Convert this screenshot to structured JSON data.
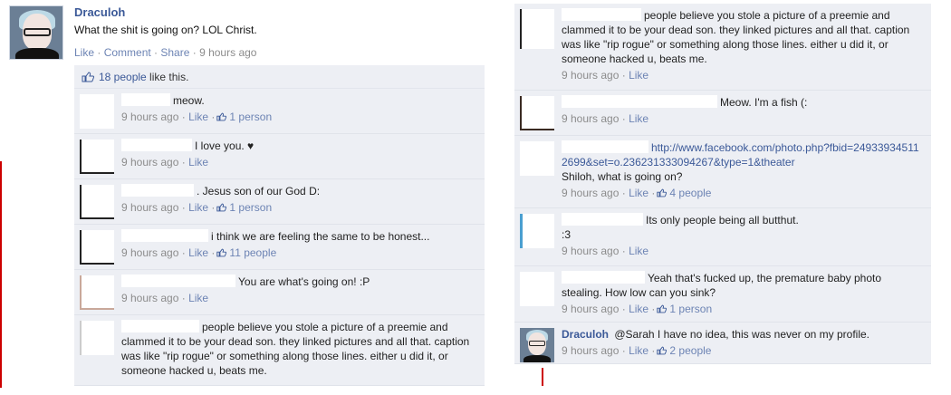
{
  "post": {
    "author": "Draculoh",
    "message": "What the shit is going on? LOL Christ.",
    "actions": [
      "Like",
      "Comment",
      "Share"
    ],
    "time": "9 hours ago",
    "likes_text": "18 people",
    "likes_suffix": " like this."
  },
  "left_comments": [
    {
      "text": "meow.",
      "time": "9 hours ago",
      "like": "Like",
      "likes": "1 person"
    },
    {
      "text": "I love you. ♥",
      "time": "9 hours ago",
      "like": "Like",
      "likes": ""
    },
    {
      "text": ". Jesus son of our God D:",
      "time": "9 hours ago",
      "like": "Like",
      "likes": "1 person"
    },
    {
      "text": "i think we are feeling the same to be honest...",
      "time": "9 hours ago",
      "like": "Like",
      "likes": "11 people"
    },
    {
      "text": "You are what's going on! :P",
      "time": "9 hours ago",
      "like": "Like",
      "likes": ""
    },
    {
      "text": "people believe you stole a picture of a preemie and clammed it to be your dead son. they linked pictures and all that. caption was like \"rip rogue\" or something along those lines. either u did it, or someone hacked u, beats me.",
      "time": "",
      "like": "",
      "likes": ""
    }
  ],
  "right_comments": [
    {
      "text": "people believe you stole a picture of a preemie and clammed it to be your dead son. they linked pictures and all that. caption was like \"rip rogue\" or something along those lines. either u did it, or someone hacked u, beats me.",
      "time": "9 hours ago",
      "like": "Like",
      "likes": ""
    },
    {
      "text": "Meow. I'm a fish (:",
      "time": "9 hours ago",
      "like": "Like",
      "likes": ""
    },
    {
      "link": "http://www.facebook.com/photo.php?fbid=249339345112699&set=o.236231333094267&type=1&theater",
      "text": "Shiloh, what is going on?",
      "time": "9 hours ago",
      "like": "Like",
      "likes": "4 people"
    },
    {
      "text": "Its only people being all butthut.",
      "text2": ":3",
      "time": "9 hours ago",
      "like": "Like",
      "likes": ""
    },
    {
      "text": "Yeah that's fucked up, the premature baby photo stealing. How low can you sink?",
      "time": "9 hours ago",
      "like": "Like",
      "likes": "1 person"
    },
    {
      "author": "Draculoh",
      "text": "@Sarah I have no idea, this was never on my profile.",
      "time": "9 hours ago",
      "like": "Like",
      "likes": "2 people"
    }
  ]
}
